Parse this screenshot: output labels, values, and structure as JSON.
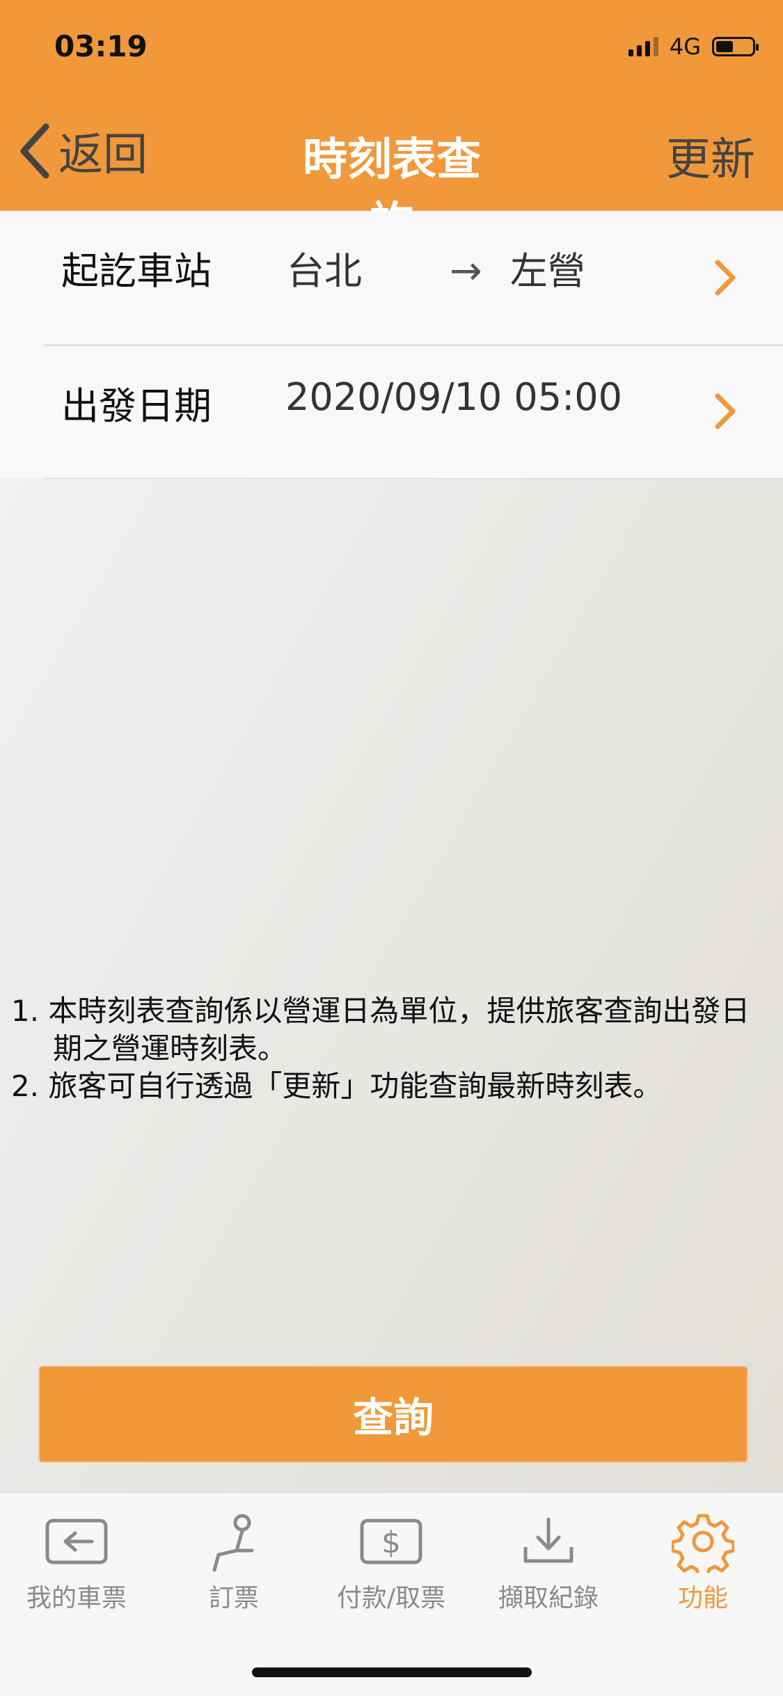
{
  "status": {
    "time": "03:19",
    "network": "4G"
  },
  "nav": {
    "back_label": "返回",
    "title": "時刻表查詢",
    "refresh_label": "更新"
  },
  "rows": {
    "station": {
      "label": "起訖車站",
      "from": "台北",
      "to": "左營"
    },
    "date": {
      "label": "出發日期",
      "value": "2020/09/10 05:00"
    }
  },
  "notes": [
    "1. 本時刻表查詢係以營運日為單位，提供旅客查詢出發日",
    "期之營運時刻表。",
    "2. 旅客可自行透過「更新」功能查詢最新時刻表。"
  ],
  "query_button": "查詢",
  "tabs": [
    {
      "label": "我的車票",
      "icon": "ticket-icon"
    },
    {
      "label": "訂票",
      "icon": "seat-icon"
    },
    {
      "label": "付款/取票",
      "icon": "payment-icon"
    },
    {
      "label": "擷取紀錄",
      "icon": "download-icon"
    },
    {
      "label": "功能",
      "icon": "gear-icon",
      "active": true
    }
  ],
  "colors": {
    "accent": "#F0983A",
    "tab_inactive": "#8a8a8a"
  }
}
